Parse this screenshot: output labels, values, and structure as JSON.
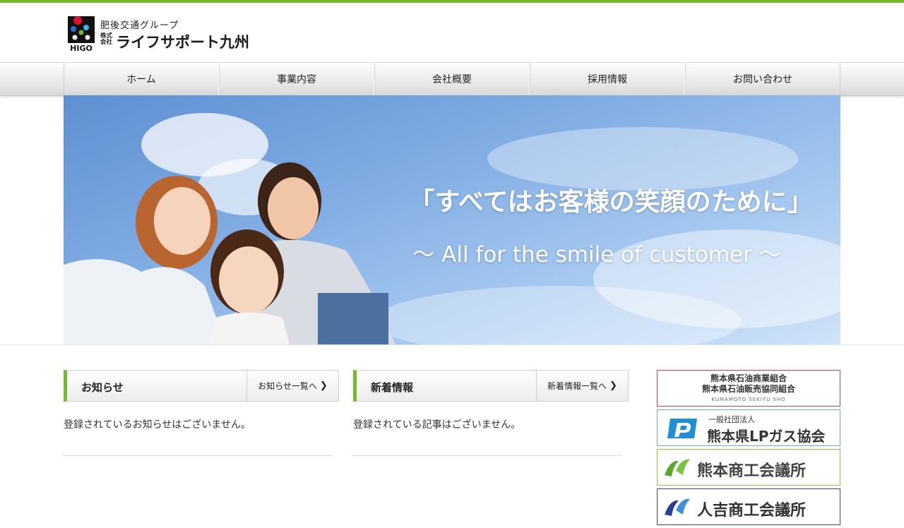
{
  "colors": {
    "accent": "#77b82d",
    "header_bg": "#ffffff",
    "sky": "#7eaae2"
  },
  "header": {
    "logo_badge": "HIGO",
    "group_label": "肥後交通グループ",
    "company_type": "株式会社",
    "company_name": "ライフサポート九州"
  },
  "nav": [
    {
      "label": "ホーム"
    },
    {
      "label": "事業内容"
    },
    {
      "label": "会社概要"
    },
    {
      "label": "採用情報"
    },
    {
      "label": "お問い合わせ"
    }
  ],
  "hero": {
    "tagline": "「すべてはお客様の笑顔のために」",
    "subtitle": "〜 All for the smile of customer 〜"
  },
  "news": {
    "title": "お知らせ",
    "link": "お知らせ一覧へ",
    "empty_message": "登録されているお知らせはございません。",
    "chevron_icon": "chevron-right-icon"
  },
  "updates": {
    "title": "新着情報",
    "link": "新着情報一覧へ",
    "empty_message": "登録されている記事はございません。",
    "chevron_icon": "chevron-right-icon"
  },
  "banners": [
    {
      "line1": "熊本県石油商業組合",
      "line2": "熊本県石油販売協同組合",
      "line3": "KUMAMOTO SEKIYU SHO"
    },
    {
      "small": "一般社団法人",
      "name": "熊本県LPガス協会"
    },
    {
      "name": "熊本商工会議所"
    },
    {
      "name": "人吉商工会議所"
    }
  ]
}
